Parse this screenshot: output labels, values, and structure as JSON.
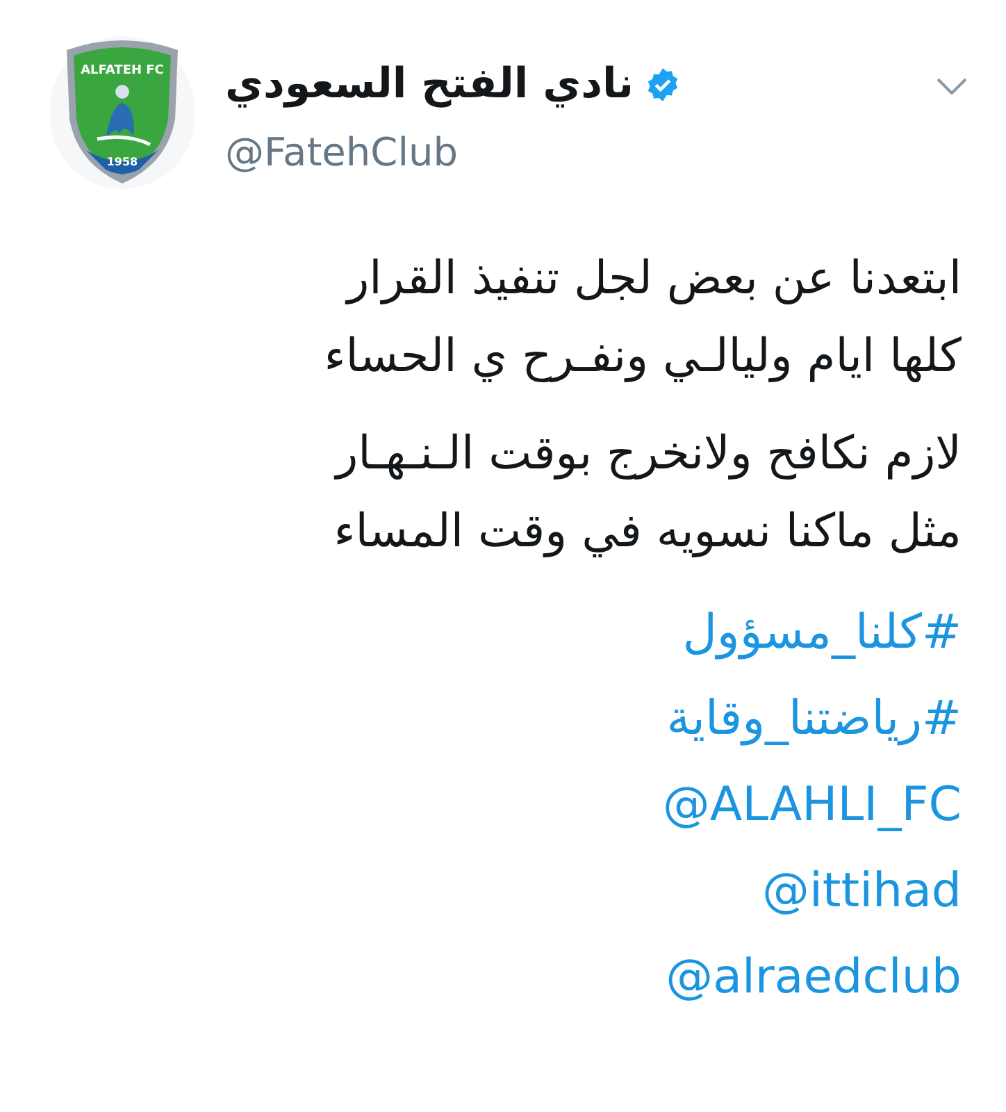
{
  "author": {
    "logo_text": "ALFATEH FC",
    "logo_year": "1958",
    "name": "نادي الفتح السعودي",
    "verified": true,
    "handle": "@FatehClub"
  },
  "paragraphs": [
    [
      "ابتعدنا عن بعض لجل تنفيذ القرار",
      "كلها ايام وليالـي ونفـرح ي الحساء"
    ],
    [
      "لازم نكافح ولانخرج بوقت الـنـهـار",
      "مثل ماكنا نسويه في وقت المساء"
    ]
  ],
  "links": [
    "#كلنا_مسؤول",
    "#رياضتنا_وقاية",
    "@ALAHLI_FC",
    "@ittihad",
    "@alraedclub"
  ]
}
